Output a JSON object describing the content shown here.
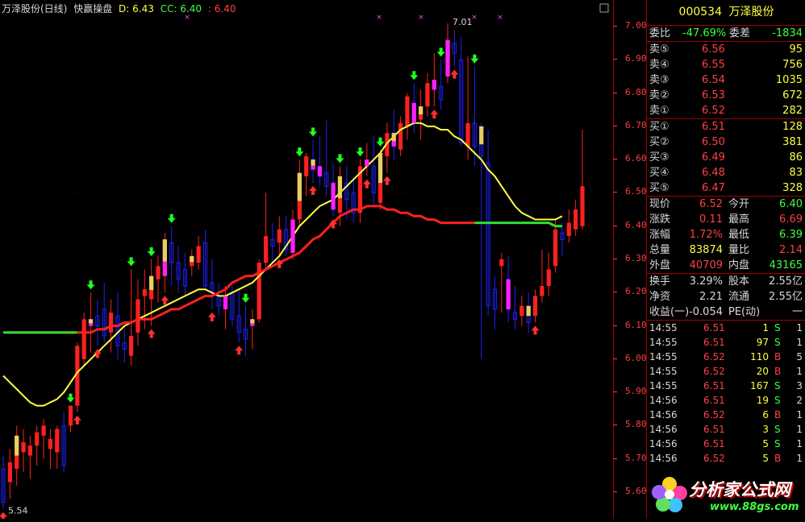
{
  "chart_header": {
    "title": "万泽股份(日线)",
    "indicator": "快赢操盘",
    "d_label": "D: 6.43",
    "cc_label": "CC: 6.40",
    "last_label": ": 6.40"
  },
  "annotations": {
    "high": "7.01",
    "low": "5.54"
  },
  "price_ticks": [
    "7.00",
    "6.90",
    "6.80",
    "6.70",
    "6.60",
    "6.50",
    "6.40",
    "6.30",
    "6.20",
    "6.10",
    "6.00",
    "5.90",
    "5.80",
    "5.70",
    "5.60"
  ],
  "panel": {
    "code": "000534",
    "name": "万泽股份",
    "weibi": {
      "label": "委比",
      "value": "-47.69%",
      "label2": "委差",
      "value2": "-1834"
    },
    "sells": [
      {
        "label": "卖⑤",
        "price": "6.56",
        "vol": "95"
      },
      {
        "label": "卖④",
        "price": "6.55",
        "vol": "756"
      },
      {
        "label": "卖③",
        "price": "6.54",
        "vol": "1035"
      },
      {
        "label": "卖②",
        "price": "6.53",
        "vol": "672"
      },
      {
        "label": "卖①",
        "price": "6.52",
        "vol": "282"
      }
    ],
    "buys": [
      {
        "label": "买①",
        "price": "6.51",
        "vol": "128"
      },
      {
        "label": "买②",
        "price": "6.50",
        "vol": "381"
      },
      {
        "label": "买③",
        "price": "6.49",
        "vol": "86"
      },
      {
        "label": "买④",
        "price": "6.48",
        "vol": "83"
      },
      {
        "label": "买⑤",
        "price": "6.47",
        "vol": "328"
      }
    ],
    "stats": [
      {
        "l1": "现价",
        "v1": "6.52",
        "c1": "red",
        "l2": "今开",
        "v2": "6.40",
        "c2": "grn"
      },
      {
        "l1": "涨跌",
        "v1": "0.11",
        "c1": "red",
        "l2": "最高",
        "v2": "6.69",
        "c2": "red"
      },
      {
        "l1": "涨幅",
        "v1": "1.72%",
        "c1": "red",
        "l2": "最低",
        "v2": "6.39",
        "c2": "grn"
      },
      {
        "l1": "总量",
        "v1": "83874",
        "c1": "yel",
        "l2": "量比",
        "v2": "2.14",
        "c2": "red"
      },
      {
        "l1": "外盘",
        "v1": "40709",
        "c1": "red",
        "l2": "内盘",
        "v2": "43165",
        "c2": "grn"
      }
    ],
    "finance": [
      {
        "l1": "换手",
        "v1": "3.29%",
        "l2": "股本",
        "v2": "2.55亿"
      },
      {
        "l1": "净资",
        "v1": "2.21",
        "l2": "流通",
        "v2": "2.55亿"
      },
      {
        "l1": "收益(一)",
        "v1": "-0.054",
        "l2": "PE(动)",
        "v2": "一"
      }
    ],
    "ticks": [
      {
        "time": "14:55",
        "price": "6.51",
        "pc": "red",
        "vol": "1",
        "side": "S",
        "n": "1"
      },
      {
        "time": "14:55",
        "price": "6.51",
        "pc": "red",
        "vol": "97",
        "side": "S",
        "n": "1"
      },
      {
        "time": "14:55",
        "price": "6.52",
        "pc": "red",
        "vol": "110",
        "side": "B",
        "n": "5"
      },
      {
        "time": "14:55",
        "price": "6.52",
        "pc": "red",
        "vol": "20",
        "side": "B",
        "n": "1"
      },
      {
        "time": "14:55",
        "price": "6.51",
        "pc": "red",
        "vol": "167",
        "side": "S",
        "n": "3"
      },
      {
        "time": "14:56",
        "price": "6.51",
        "pc": "red",
        "vol": "19",
        "side": "S",
        "n": "2"
      },
      {
        "time": "14:56",
        "price": "6.52",
        "pc": "red",
        "vol": "6",
        "side": "B",
        "n": "1"
      },
      {
        "time": "14:56",
        "price": "6.51",
        "pc": "red",
        "vol": "3",
        "side": "S",
        "n": "1"
      },
      {
        "time": "14:56",
        "price": "6.51",
        "pc": "red",
        "vol": "5",
        "side": "S",
        "n": "1"
      },
      {
        "time": "14:56",
        "price": "6.52",
        "pc": "red",
        "vol": "5",
        "side": "B",
        "n": "1"
      }
    ]
  },
  "watermark": {
    "brand": "分析家公式网",
    "url": "www.88gs.com"
  },
  "colors": {
    "up": "#ff2020",
    "down": "#2020ff",
    "ma_short": "#ffff40",
    "ma_long_up": "#ff2020",
    "ma_long_flat": "#30e030",
    "signal_magenta": "#ff20ff",
    "signal_gold": "#e8d060"
  },
  "chart_data": {
    "type": "candlestick",
    "ylim": [
      5.52,
      7.08
    ],
    "candles": [
      {
        "o": 5.67,
        "h": 5.71,
        "l": 5.55,
        "c": 5.57
      },
      {
        "o": 5.63,
        "h": 5.73,
        "l": 5.58,
        "c": 5.69
      },
      {
        "o": 5.67,
        "h": 5.8,
        "l": 5.62,
        "c": 5.77
      },
      {
        "o": 5.72,
        "h": 5.79,
        "l": 5.66,
        "c": 5.75
      },
      {
        "o": 5.71,
        "h": 5.77,
        "l": 5.64,
        "c": 5.74
      },
      {
        "o": 5.74,
        "h": 5.8,
        "l": 5.68,
        "c": 5.78
      },
      {
        "o": 5.77,
        "h": 5.82,
        "l": 5.7,
        "c": 5.8
      },
      {
        "o": 5.73,
        "h": 5.79,
        "l": 5.67,
        "c": 5.76
      },
      {
        "o": 5.72,
        "h": 5.8,
        "l": 5.67,
        "c": 5.79
      },
      {
        "o": 5.8,
        "h": 5.84,
        "l": 5.66,
        "c": 5.68
      },
      {
        "o": 5.8,
        "h": 5.86,
        "l": 5.78,
        "c": 5.86
      },
      {
        "o": 5.86,
        "h": 6.05,
        "l": 5.84,
        "c": 6.04
      },
      {
        "o": 6.0,
        "h": 6.14,
        "l": 5.98,
        "c": 6.12
      },
      {
        "o": 6.1,
        "h": 6.2,
        "l": 6.02,
        "c": 6.12
      },
      {
        "o": 6.13,
        "h": 6.18,
        "l": 6.04,
        "c": 6.1
      },
      {
        "o": 6.15,
        "h": 6.23,
        "l": 6.05,
        "c": 6.07
      },
      {
        "o": 6.08,
        "h": 6.18,
        "l": 6.02,
        "c": 6.14
      },
      {
        "o": 6.13,
        "h": 6.2,
        "l": 6.0,
        "c": 6.04
      },
      {
        "o": 6.05,
        "h": 6.1,
        "l": 5.99,
        "c": 6.03
      },
      {
        "o": 6.01,
        "h": 6.27,
        "l": 5.98,
        "c": 6.07
      },
      {
        "o": 6.08,
        "h": 6.24,
        "l": 6.04,
        "c": 6.18
      },
      {
        "o": 6.19,
        "h": 6.27,
        "l": 6.09,
        "c": 6.21
      },
      {
        "o": 6.18,
        "h": 6.3,
        "l": 6.1,
        "c": 6.25
      },
      {
        "o": 6.24,
        "h": 6.31,
        "l": 6.17,
        "c": 6.28
      },
      {
        "o": 6.25,
        "h": 6.38,
        "l": 6.2,
        "c": 6.36
      },
      {
        "o": 6.35,
        "h": 6.4,
        "l": 6.22,
        "c": 6.29
      },
      {
        "o": 6.29,
        "h": 6.34,
        "l": 6.2,
        "c": 6.24
      },
      {
        "o": 6.27,
        "h": 6.32,
        "l": 6.19,
        "c": 6.22
      },
      {
        "o": 6.28,
        "h": 6.33,
        "l": 6.25,
        "c": 6.31
      },
      {
        "o": 6.29,
        "h": 6.37,
        "l": 6.27,
        "c": 6.34
      },
      {
        "o": 6.35,
        "h": 6.39,
        "l": 6.21,
        "c": 6.22
      },
      {
        "o": 6.23,
        "h": 6.3,
        "l": 6.15,
        "c": 6.2
      },
      {
        "o": 6.19,
        "h": 6.23,
        "l": 6.13,
        "c": 6.16
      },
      {
        "o": 6.15,
        "h": 6.22,
        "l": 6.09,
        "c": 6.19
      },
      {
        "o": 6.2,
        "h": 6.22,
        "l": 6.1,
        "c": 6.12
      },
      {
        "o": 6.13,
        "h": 6.21,
        "l": 6.05,
        "c": 6.08
      },
      {
        "o": 6.09,
        "h": 6.16,
        "l": 6.01,
        "c": 6.06
      },
      {
        "o": 6.1,
        "h": 6.15,
        "l": 6.03,
        "c": 6.12
      },
      {
        "o": 6.12,
        "h": 6.3,
        "l": 6.11,
        "c": 6.29
      },
      {
        "o": 6.29,
        "h": 6.5,
        "l": 6.27,
        "c": 6.37
      },
      {
        "o": 6.36,
        "h": 6.41,
        "l": 6.29,
        "c": 6.34
      },
      {
        "o": 6.35,
        "h": 6.43,
        "l": 6.31,
        "c": 6.39
      },
      {
        "o": 6.39,
        "h": 6.43,
        "l": 6.31,
        "c": 6.33
      },
      {
        "o": 6.32,
        "h": 6.45,
        "l": 6.3,
        "c": 6.42
      },
      {
        "o": 6.42,
        "h": 6.6,
        "l": 6.4,
        "c": 6.56
      },
      {
        "o": 6.55,
        "h": 6.62,
        "l": 6.49,
        "c": 6.61
      },
      {
        "o": 6.6,
        "h": 6.66,
        "l": 6.53,
        "c": 6.57
      },
      {
        "o": 6.58,
        "h": 6.67,
        "l": 6.52,
        "c": 6.55
      },
      {
        "o": 6.56,
        "h": 6.72,
        "l": 6.49,
        "c": 6.52
      },
      {
        "o": 6.53,
        "h": 6.59,
        "l": 6.43,
        "c": 6.45
      },
      {
        "o": 6.44,
        "h": 6.58,
        "l": 6.4,
        "c": 6.55
      },
      {
        "o": 6.53,
        "h": 6.58,
        "l": 6.42,
        "c": 6.48
      },
      {
        "o": 6.5,
        "h": 6.55,
        "l": 6.41,
        "c": 6.44
      },
      {
        "o": 6.44,
        "h": 6.6,
        "l": 6.41,
        "c": 6.58
      },
      {
        "o": 6.58,
        "h": 6.65,
        "l": 6.55,
        "c": 6.6
      },
      {
        "o": 6.58,
        "h": 6.67,
        "l": 6.46,
        "c": 6.5
      },
      {
        "o": 6.47,
        "h": 6.63,
        "l": 6.45,
        "c": 6.62
      },
      {
        "o": 6.61,
        "h": 6.71,
        "l": 6.56,
        "c": 6.68
      },
      {
        "o": 6.68,
        "h": 6.75,
        "l": 6.6,
        "c": 6.64
      },
      {
        "o": 6.63,
        "h": 6.73,
        "l": 6.61,
        "c": 6.71
      },
      {
        "o": 6.7,
        "h": 6.8,
        "l": 6.66,
        "c": 6.79
      },
      {
        "o": 6.77,
        "h": 6.83,
        "l": 6.68,
        "c": 6.71
      },
      {
        "o": 6.72,
        "h": 6.81,
        "l": 6.66,
        "c": 6.76
      },
      {
        "o": 6.76,
        "h": 6.86,
        "l": 6.73,
        "c": 6.83
      },
      {
        "o": 6.81,
        "h": 6.92,
        "l": 6.76,
        "c": 6.84
      },
      {
        "o": 6.82,
        "h": 6.9,
        "l": 6.75,
        "c": 6.78
      },
      {
        "o": 6.85,
        "h": 7.01,
        "l": 6.83,
        "c": 6.96
      },
      {
        "o": 6.95,
        "h": 6.99,
        "l": 6.88,
        "c": 6.92
      },
      {
        "o": 6.9,
        "h": 6.97,
        "l": 6.64,
        "c": 6.65
      },
      {
        "o": 6.64,
        "h": 6.91,
        "l": 6.6,
        "c": 6.71
      },
      {
        "o": 6.71,
        "h": 6.88,
        "l": 6.58,
        "c": 6.64
      },
      {
        "o": 6.7,
        "h": 6.71,
        "l": 6.0,
        "c": 6.61
      },
      {
        "o": 6.59,
        "h": 6.69,
        "l": 6.13,
        "c": 6.16
      },
      {
        "o": 6.21,
        "h": 6.25,
        "l": 6.09,
        "c": 6.15
      },
      {
        "o": 6.28,
        "h": 6.32,
        "l": 6.14,
        "c": 6.3
      },
      {
        "o": 6.24,
        "h": 6.31,
        "l": 6.11,
        "c": 6.15
      },
      {
        "o": 6.14,
        "h": 6.22,
        "l": 6.09,
        "c": 6.12
      },
      {
        "o": 6.13,
        "h": 6.19,
        "l": 6.1,
        "c": 6.16
      },
      {
        "o": 6.16,
        "h": 6.2,
        "l": 6.08,
        "c": 6.11
      },
      {
        "o": 6.13,
        "h": 6.21,
        "l": 6.11,
        "c": 6.19
      },
      {
        "o": 6.19,
        "h": 6.33,
        "l": 6.17,
        "c": 6.22
      },
      {
        "o": 6.22,
        "h": 6.32,
        "l": 6.19,
        "c": 6.27
      },
      {
        "o": 6.28,
        "h": 6.42,
        "l": 6.26,
        "c": 6.39
      },
      {
        "o": 6.38,
        "h": 6.41,
        "l": 6.31,
        "c": 6.36
      },
      {
        "o": 6.37,
        "h": 6.45,
        "l": 6.35,
        "c": 6.41
      },
      {
        "o": 6.39,
        "h": 6.48,
        "l": 6.37,
        "c": 6.45
      },
      {
        "o": 6.4,
        "h": 6.69,
        "l": 6.39,
        "c": 6.52
      }
    ],
    "ma_short": [
      5.95,
      5.93,
      5.91,
      5.89,
      5.87,
      5.86,
      5.86,
      5.87,
      5.88,
      5.9,
      5.93,
      5.96,
      5.98,
      6.0,
      6.02,
      6.04,
      6.06,
      6.08,
      6.1,
      6.11,
      6.12,
      6.13,
      6.14,
      6.15,
      6.16,
      6.17,
      6.18,
      6.19,
      6.2,
      6.21,
      6.21,
      6.2,
      6.19,
      6.19,
      6.2,
      6.21,
      6.22,
      6.23,
      6.25,
      6.27,
      6.29,
      6.31,
      6.34,
      6.37,
      6.4,
      6.42,
      6.44,
      6.46,
      6.47,
      6.48,
      6.5,
      6.52,
      6.54,
      6.56,
      6.58,
      6.6,
      6.62,
      6.65,
      6.67,
      6.69,
      6.7,
      6.71,
      6.71,
      6.7,
      6.7,
      6.69,
      6.69,
      6.67,
      6.66,
      6.64,
      6.62,
      6.6,
      6.57,
      6.55,
      6.52,
      6.49,
      6.46,
      6.44,
      6.43,
      6.42,
      6.42,
      6.42,
      6.42,
      6.43
    ],
    "ma_long": [
      6.08,
      6.08,
      6.08,
      6.08,
      6.08,
      6.08,
      6.08,
      6.08,
      6.08,
      6.08,
      6.08,
      6.08,
      6.08,
      6.08,
      6.09,
      6.09,
      6.1,
      6.1,
      6.11,
      6.11,
      6.12,
      6.12,
      6.12,
      6.13,
      6.14,
      6.15,
      6.15,
      6.16,
      6.17,
      6.18,
      6.19,
      6.19,
      6.2,
      6.21,
      6.23,
      6.24,
      6.25,
      6.25,
      6.26,
      6.27,
      6.28,
      6.29,
      6.3,
      6.31,
      6.32,
      6.34,
      6.36,
      6.37,
      6.39,
      6.41,
      6.43,
      6.44,
      6.45,
      6.45,
      6.46,
      6.46,
      6.46,
      6.45,
      6.45,
      6.44,
      6.44,
      6.43,
      6.43,
      6.42,
      6.42,
      6.41,
      6.41,
      6.41,
      6.41,
      6.41,
      6.41,
      6.41,
      6.41,
      6.41,
      6.41,
      6.41,
      6.41,
      6.41,
      6.41,
      6.41,
      6.41,
      6.41,
      6.4,
      6.4
    ]
  }
}
